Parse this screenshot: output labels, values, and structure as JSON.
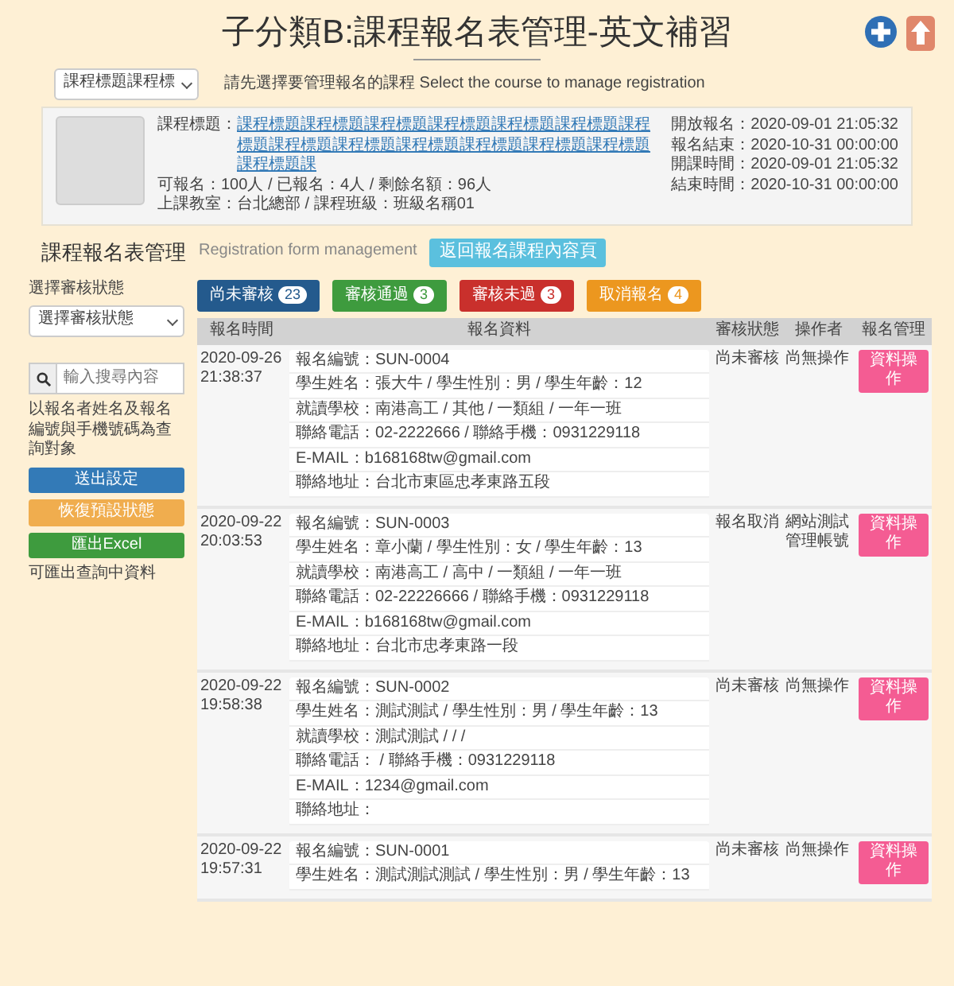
{
  "page_title": "子分類B:課程報名表管理-英文補習",
  "course_select": {
    "value": "課程標題課程標",
    "hint": "請先選擇要管理報名的課程 Select the course to manage registration"
  },
  "course_info": {
    "title_label": "課程標題：",
    "title_link": "課程標題課程標題課程標題課程標題課程標題課程標題課程標題課程標題課程標題課程標題課程標題課程標題課程標題課程標題課",
    "quota": "可報名：100人 / 已報名：4人 / 剩餘名額：96人",
    "location": "上課教室：台北總部 / 課程班級：班級名稱01",
    "dates": [
      "開放報名：2020-09-01 21:05:32",
      "報名結束：2020-10-31 00:00:00",
      "開課時間：2020-09-01 21:05:32",
      "結束時間：2020-10-31 00:00:00"
    ]
  },
  "section": {
    "title": "課程報名表管理",
    "subtitle": "Registration form management",
    "back_button": "返回報名課程內容頁"
  },
  "sidebar": {
    "status_label": "選擇審核狀態",
    "status_select": "選擇審核狀態",
    "search_placeholder": "輸入搜尋內容",
    "search_hint": "以報名者姓名及報名編號與手機號碼為查詢對象",
    "buttons": [
      {
        "label": "送出設定",
        "color": "#337ab7"
      },
      {
        "label": "恢復預設狀態",
        "color": "#f0ad4e"
      },
      {
        "label": "匯出Excel",
        "color": "#3e9b3e"
      }
    ],
    "note": "可匯出查詢中資料"
  },
  "status_filters": [
    {
      "label": "尚未審核",
      "count": "23",
      "color": "#245a8d"
    },
    {
      "label": "審核通過",
      "count": "3",
      "color": "#3e9b3e"
    },
    {
      "label": "審核未過",
      "count": "3",
      "color": "#c9302c"
    },
    {
      "label": "取消報名",
      "count": "4",
      "color": "#ec971f"
    }
  ],
  "table": {
    "columns": [
      "報名時間",
      "報名資料",
      "審核狀態",
      "操作者",
      "報名管理"
    ],
    "rows": [
      {
        "date": "2020-09-26",
        "time": "21:38:37",
        "details": [
          "報名編號：SUN-0004",
          "學生姓名：張大牛 / 學生性別：男 / 學生年齡：12",
          "就讀學校：南港高工 / 其他 / 一類組 / 一年一班",
          "聯絡電話：02-2222666 / 聯絡手機：0931229118",
          "E-MAIL：b168168tw@gmail.com",
          "聯絡地址：台北市東區忠孝東路五段"
        ],
        "status": "尚未審核",
        "operator": "尚無操作",
        "action": "資料操作"
      },
      {
        "date": "2020-09-22",
        "time": "20:03:53",
        "details": [
          "報名編號：SUN-0003",
          "學生姓名：章小蘭 / 學生性別：女 / 學生年齡：13",
          "就讀學校：南港高工 / 高中 / 一類組 / 一年一班",
          "聯絡電話：02-22226666 / 聯絡手機：0931229118",
          "E-MAIL：b168168tw@gmail.com",
          "聯絡地址：台北市忠孝東路一段"
        ],
        "status": "報名取消",
        "operator": "網站測試管理帳號",
        "action": "資料操作"
      },
      {
        "date": "2020-09-22",
        "time": "19:58:38",
        "details": [
          "報名編號：SUN-0002",
          "學生姓名：測試測試 / 學生性別：男 / 學生年齡：13",
          "就讀學校：測試測試 / / /",
          "聯絡電話： / 聯絡手機：0931229118",
          "E-MAIL：1234@gmail.com",
          "聯絡地址："
        ],
        "status": "尚未審核",
        "operator": "尚無操作",
        "action": "資料操作"
      },
      {
        "date": "2020-09-22",
        "time": "19:57:31",
        "details": [
          "報名編號：SUN-0001",
          "學生姓名：測試測試測試 / 學生性別：男 / 學生年齡：13"
        ],
        "status": "尚未審核",
        "operator": "尚無操作",
        "action": "資料操作"
      }
    ]
  }
}
